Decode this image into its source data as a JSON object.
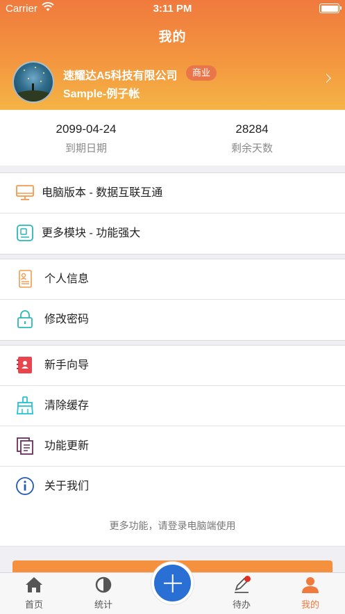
{
  "status_bar": {
    "carrier": "Carrier",
    "time": "3:11 PM"
  },
  "header": {
    "title": "我的"
  },
  "profile": {
    "company": "速耀达A5科技有限公司",
    "badge": "商业",
    "account": "Sample-例子帐"
  },
  "stats": [
    {
      "value": "2099-04-24",
      "label": "到期日期"
    },
    {
      "value": "28284",
      "label": "剩余天数"
    }
  ],
  "group1": [
    {
      "label": "电脑版本 - 数据互联互通",
      "icon": "monitor-icon"
    },
    {
      "label": "更多模块 - 功能强大",
      "icon": "module-icon"
    }
  ],
  "group2": [
    {
      "label": "个人信息",
      "icon": "id-card-icon"
    },
    {
      "label": "修改密码",
      "icon": "lock-icon"
    }
  ],
  "group3": [
    {
      "label": "新手向导",
      "icon": "guide-book-icon"
    },
    {
      "label": "清除缓存",
      "icon": "broom-icon"
    },
    {
      "label": "功能更新",
      "icon": "update-icon"
    },
    {
      "label": "关于我们",
      "icon": "info-icon"
    }
  ],
  "footer_note": "更多功能，请登录电脑端使用",
  "tabs": [
    {
      "label": "首页",
      "icon": "home-icon"
    },
    {
      "label": "统计",
      "icon": "stats-icon"
    },
    {
      "label": "待办",
      "icon": "edit-icon"
    },
    {
      "label": "我的",
      "icon": "user-icon"
    }
  ],
  "colors": {
    "accent": "#f07a3e",
    "primary_blue": "#2a6fd4",
    "notification": "#e02e24"
  }
}
